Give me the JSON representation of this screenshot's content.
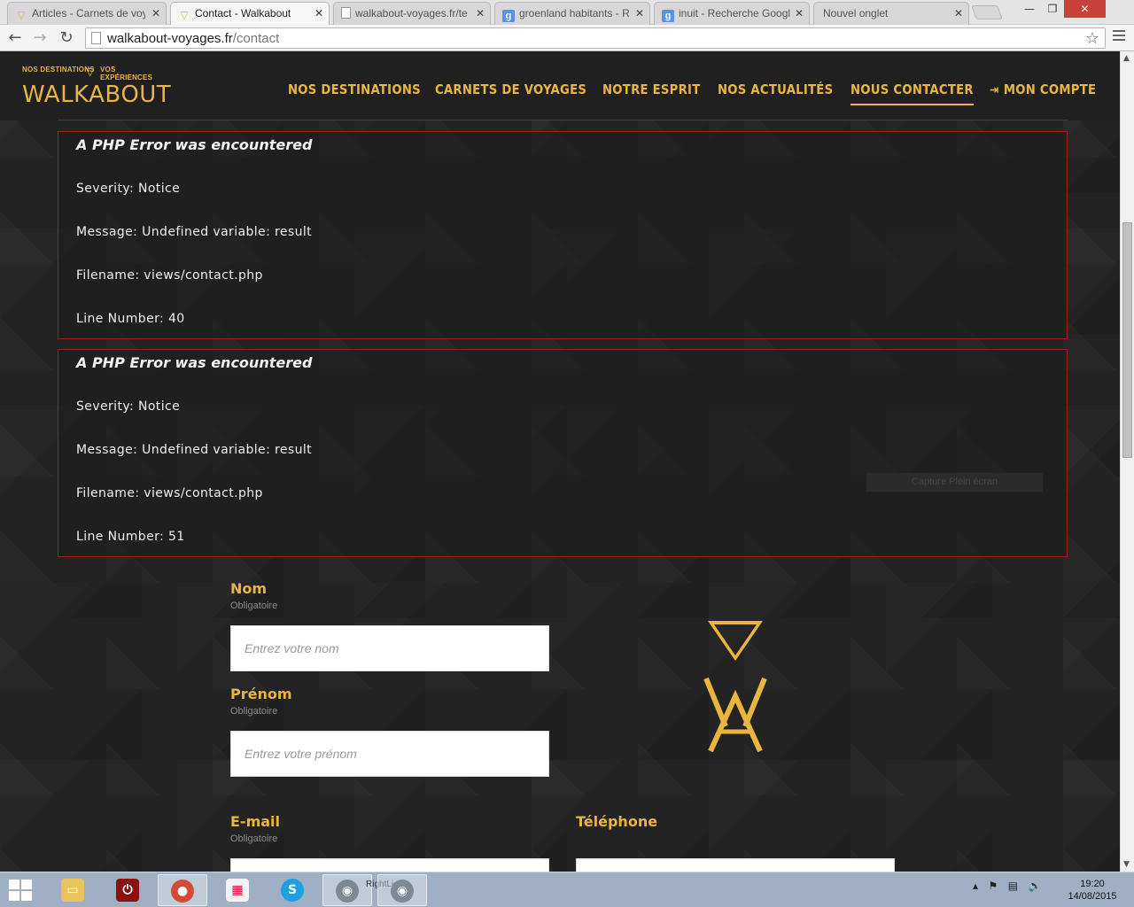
{
  "browser": {
    "tabs": [
      {
        "title": "Articles - Carnets de voy",
        "icon": "walkabout-triangle-icon"
      },
      {
        "title": "Contact - Walkabout",
        "icon": "walkabout-triangle-icon"
      },
      {
        "title": "walkabout-voyages.fr/te",
        "icon": "page-icon"
      },
      {
        "title": "groenland habitants - R",
        "icon": "google-icon"
      },
      {
        "title": "inuit - Recherche Googl",
        "icon": "google-icon"
      },
      {
        "title": "Nouvel onglet",
        "icon": ""
      }
    ],
    "url_host": "walkabout-voyages.fr",
    "url_path": "/contact"
  },
  "site": {
    "logo": {
      "tag_left": "NOS DESTINATIONS",
      "tag_right": "VOS EXPÉRIENCES",
      "word": "WALKABOUT"
    },
    "nav": [
      {
        "label": "NOS DESTINATIONS"
      },
      {
        "label": "CARNETS DE VOYAGES"
      },
      {
        "label": "NOTRE ESPRIT"
      },
      {
        "label": "NOS ACTUALITÉS"
      },
      {
        "label": "NOUS CONTACTER",
        "active": true
      },
      {
        "label": "MON COMPTE"
      }
    ],
    "accent_color": "#e8b53e",
    "error_border_color": "#9b1f1f"
  },
  "errors": [
    {
      "heading": "A PHP Error was encountered",
      "severity": "Severity: Notice",
      "message": "Message: Undefined variable: result",
      "filename": "Filename: views/contact.php",
      "line": "Line Number: 40"
    },
    {
      "heading": "A PHP Error was encountered",
      "severity": "Severity: Notice",
      "message": "Message: Undefined variable: result",
      "filename": "Filename: views/contact.php",
      "line": "Line Number: 51"
    }
  ],
  "overlay": {
    "capture": "Capture Plein écran"
  },
  "form": {
    "nom": {
      "label": "Nom",
      "sub": "Obligatoire",
      "placeholder": "Entrez votre nom"
    },
    "prenom": {
      "label": "Prénom",
      "sub": "Obligatoire",
      "placeholder": "Entrez votre prénom"
    },
    "email": {
      "label": "E-mail",
      "sub": "Obligatoire"
    },
    "telephone": {
      "label": "Téléphone"
    }
  },
  "taskbar": {
    "right_label": "RightLi",
    "time": "19:20",
    "date": "14/08/2015"
  }
}
